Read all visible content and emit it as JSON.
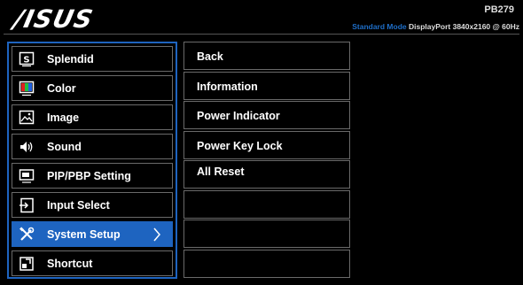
{
  "header": {
    "brand": "/ISUS",
    "model": "PB279",
    "mode_label": "Standard Mode",
    "signal": "DisplayPort  3840x2160 @ 60Hz"
  },
  "left_menu": {
    "items": [
      {
        "label": "Splendid",
        "icon": "splendid-s-icon"
      },
      {
        "label": "Color",
        "icon": "color-icon"
      },
      {
        "label": "Image",
        "icon": "image-icon"
      },
      {
        "label": "Sound",
        "icon": "speaker-icon"
      },
      {
        "label": "PIP/PBP Setting",
        "icon": "pip-icon"
      },
      {
        "label": "Input Select",
        "icon": "input-select-icon"
      },
      {
        "label": "System Setup",
        "icon": "wrench-screwdriver-icon",
        "selected": true
      },
      {
        "label": "Shortcut",
        "icon": "shortcut-icon"
      }
    ]
  },
  "right_menu": {
    "items": [
      "Back",
      "Information",
      "Power Indicator",
      "Power Key Lock",
      "All Reset",
      "",
      "",
      ""
    ]
  },
  "colors": {
    "accent": "#1e64c0",
    "mode_text": "#1e6ec8",
    "border": "#6a6a6a",
    "background": "#000000"
  }
}
